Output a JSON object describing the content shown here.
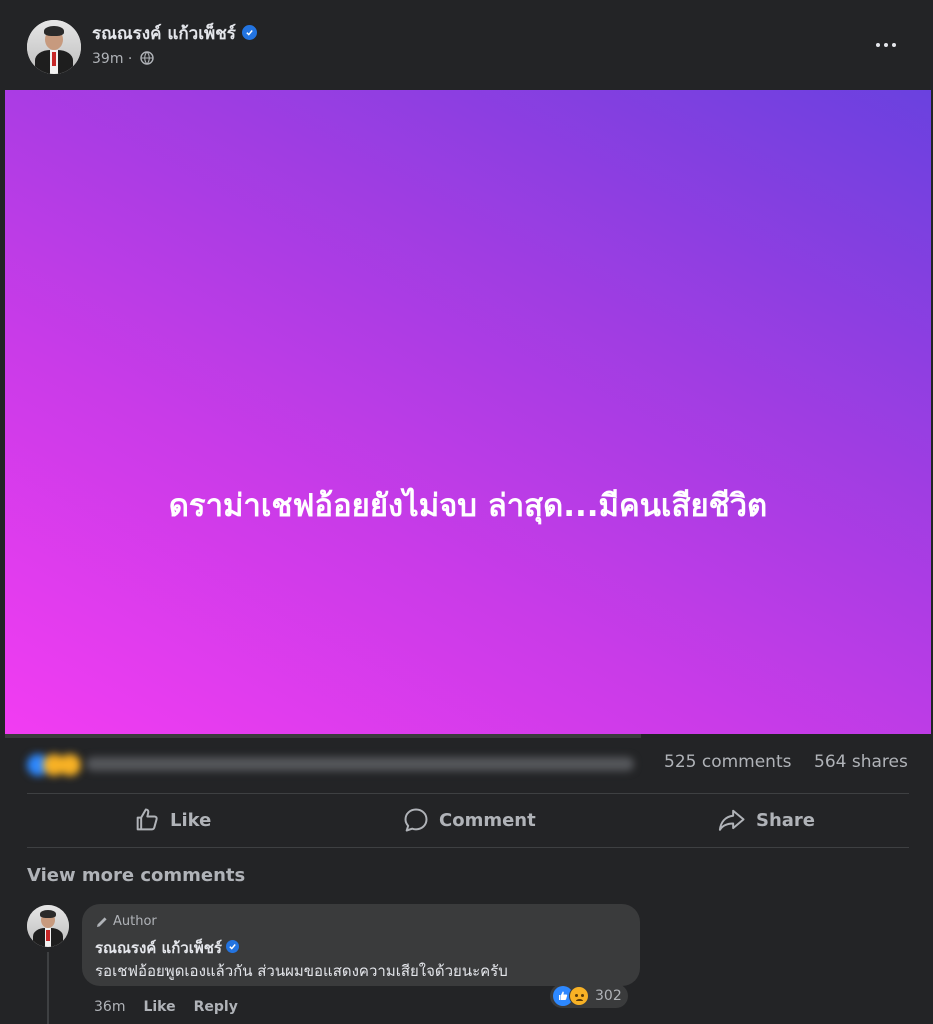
{
  "post": {
    "author": "รณณรงค์ แก้วเพ็ชร์",
    "time": "39m",
    "image_text": "ดราม่าเชฟอ้อยยังไม่จบ ล่าสุด...มีคนเสียชีวิต",
    "comments_count": "525 comments",
    "shares_count": "564 shares"
  },
  "actions": {
    "like": "Like",
    "comment": "Comment",
    "share": "Share"
  },
  "view_more": "View more comments",
  "comment": {
    "badge": "Author",
    "author": "รณณรงค์ แก้วเพ็ชร์",
    "text": "รอเชฟอ้อยพูดเองแล้วกัน ส่วนผมขอแสดงความเสียใจด้วยนะครับ",
    "reactions_count": "302",
    "time": "36m",
    "like": "Like",
    "reply": "Reply"
  },
  "colors": {
    "background": "#232426",
    "bubble": "#3a3b3c",
    "verified": "#2374e1",
    "gradient_start": "#f23cf2",
    "gradient_end": "#6a41df"
  }
}
